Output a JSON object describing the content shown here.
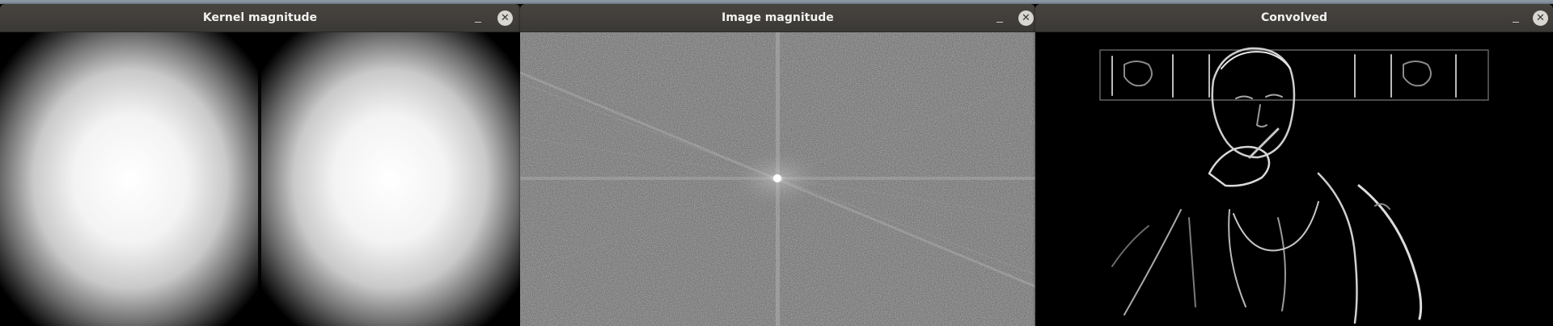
{
  "windows": [
    {
      "title": "Kernel magnitude",
      "close_glyph": "✕",
      "minimize_icon": "minimize-icon",
      "close_icon": "close-icon"
    },
    {
      "title": "Image magnitude",
      "close_glyph": "✕",
      "minimize_icon": "minimize-icon",
      "close_icon": "close-icon"
    },
    {
      "title": "Convolved",
      "close_glyph": "✕",
      "minimize_icon": "minimize-icon",
      "close_icon": "close-icon"
    }
  ],
  "colors": {
    "titlebar": "#3b3936",
    "title_text": "#f2f1f0",
    "content_bg": "#000000"
  }
}
